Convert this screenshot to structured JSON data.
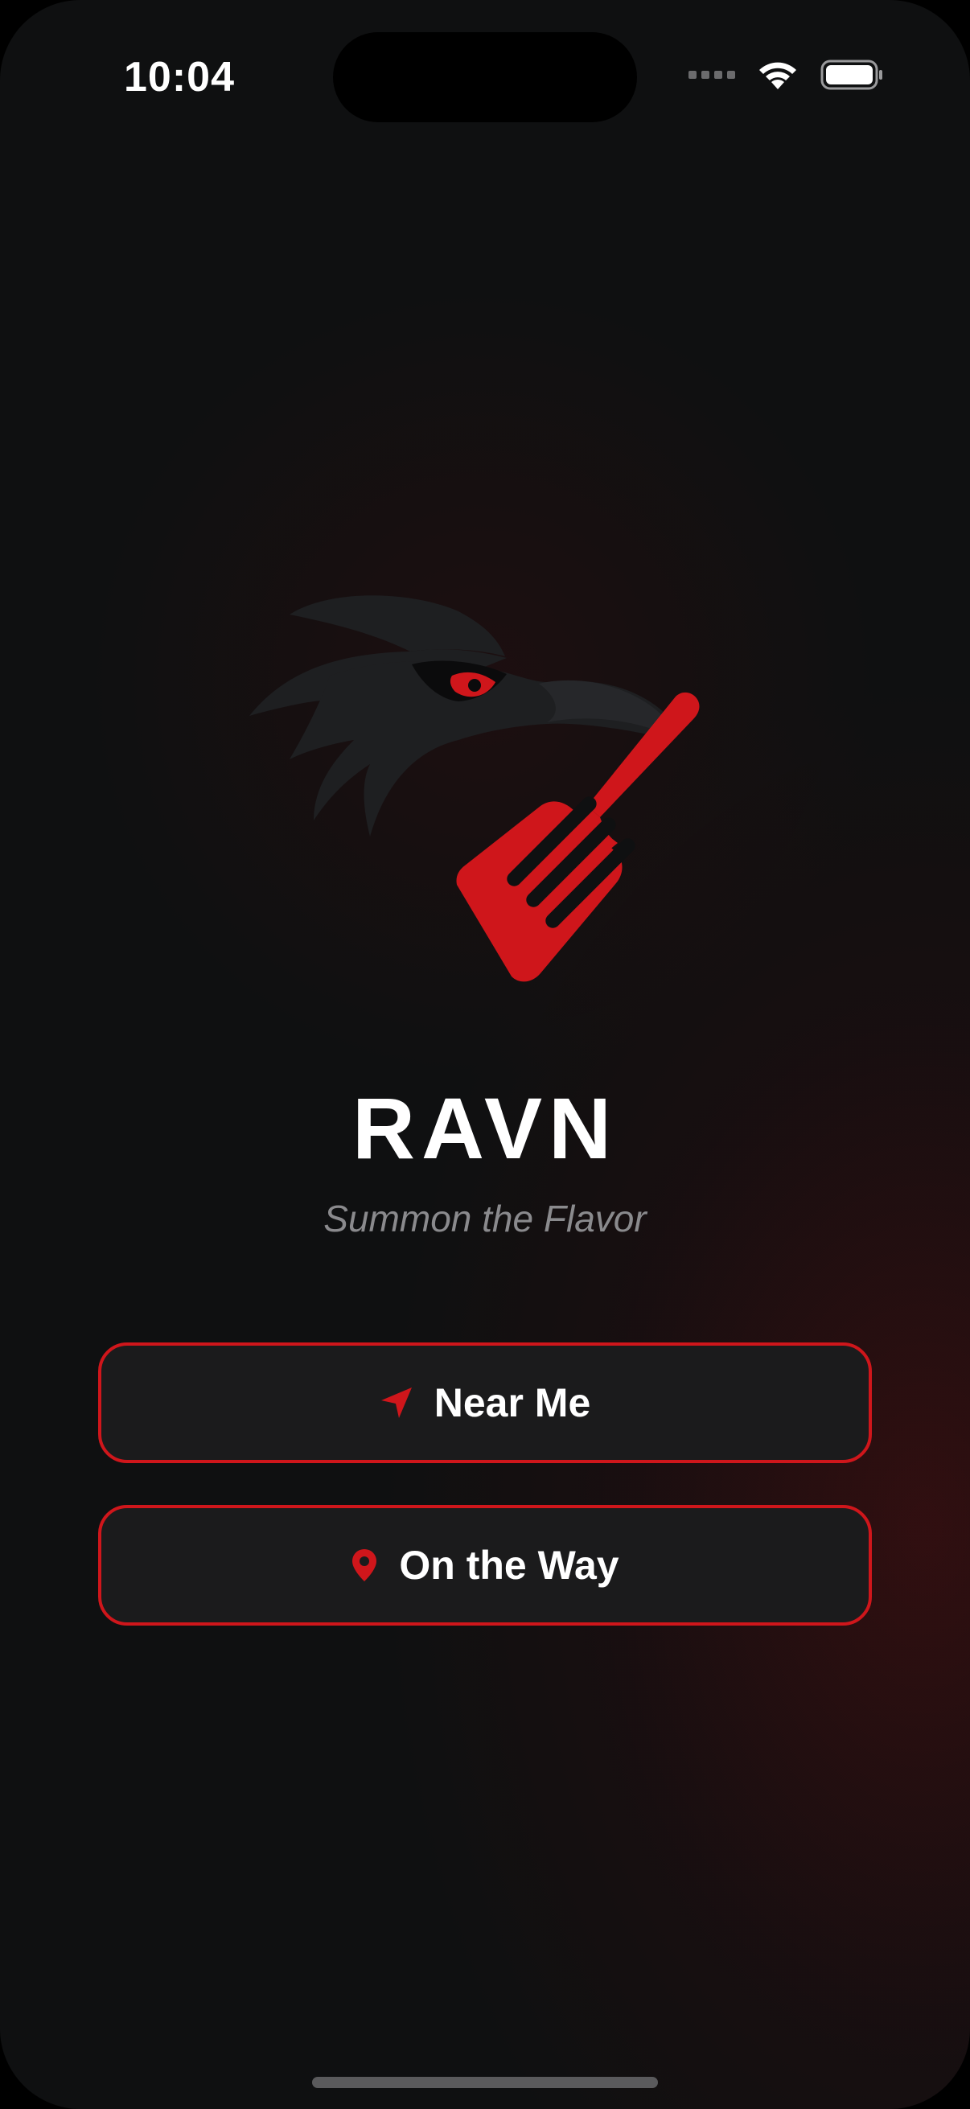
{
  "status_bar": {
    "time": "10:04",
    "icons": [
      "cellular-signal-icon",
      "wifi-icon",
      "battery-icon"
    ]
  },
  "brand": {
    "name": "RAVN",
    "tagline": "Summon the Flavor",
    "logo": "raven-with-spatula-logo"
  },
  "actions": {
    "near_me": {
      "label": "Near Me",
      "icon": "location-arrow-icon"
    },
    "on_the_way": {
      "label": "On the Way",
      "icon": "map-pin-icon"
    }
  },
  "colors": {
    "accent": "#cf161b",
    "background": "#0f1011",
    "button_fill": "#1b1b1c",
    "raven": "#1e1f21",
    "text": "#ffffff",
    "muted_text": "#8a8a8d"
  }
}
